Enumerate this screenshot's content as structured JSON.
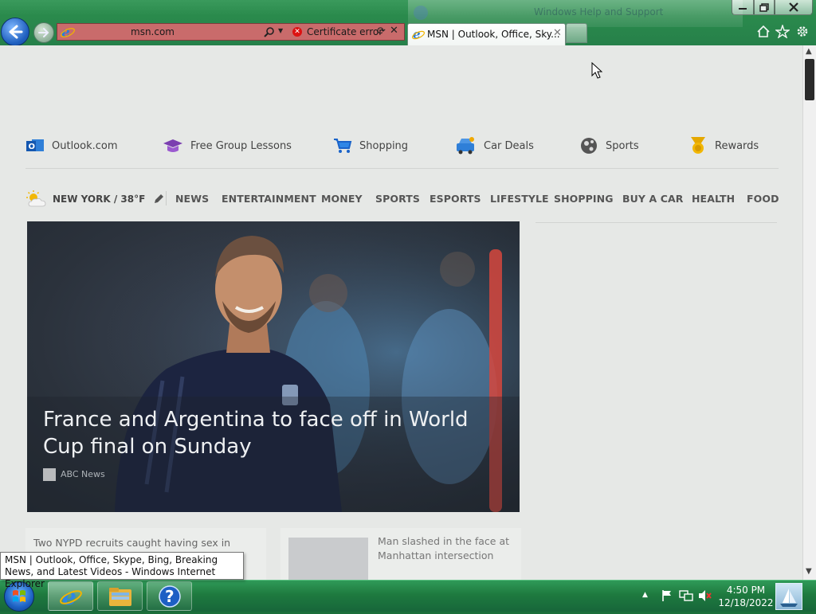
{
  "browser": {
    "address_url": "msn.com",
    "certificate_error": "Certificate error",
    "active_tab_title": "MSN | Outlook, Office, Sky...",
    "ghost_window_title": "Windows Help and Support"
  },
  "quicklinks": [
    {
      "label": "Outlook.com",
      "icon": "outlook-icon"
    },
    {
      "label": "Free Group Lessons",
      "icon": "graduation-cap-icon"
    },
    {
      "label": "Shopping",
      "icon": "shopping-cart-icon"
    },
    {
      "label": "Car Deals",
      "icon": "car-icon"
    },
    {
      "label": "Sports",
      "icon": "sports-ball-icon"
    },
    {
      "label": "Rewards",
      "icon": "rewards-medal-icon"
    }
  ],
  "weather": {
    "text": "NEW YORK / 38°F",
    "icon": "partly-cloudy-icon"
  },
  "nav": [
    "NEWS",
    "ENTERTAINMENT",
    "MONEY",
    "SPORTS",
    "ESPORTS",
    "LIFESTYLE",
    "SHOPPING",
    "BUY A CAR",
    "HEALTH",
    "FOOD"
  ],
  "hero": {
    "title": "France and Argentina to face off in World Cup final on Sunday",
    "source": "ABC News"
  },
  "cards": [
    {
      "text": "Two NYPD recruits caught having sex in Police"
    },
    {
      "text": "Man slashed in the face at Manhattan intersection"
    }
  ],
  "tooltip": "MSN | Outlook, Office, Skype, Bing, Breaking News, and Latest Videos - Windows Internet Explorer",
  "taskbar": {
    "time": "4:50 PM",
    "date": "12/18/2022"
  },
  "colors": {
    "address_error": "#c96b6b",
    "accent_green": "#2a8a4c"
  }
}
